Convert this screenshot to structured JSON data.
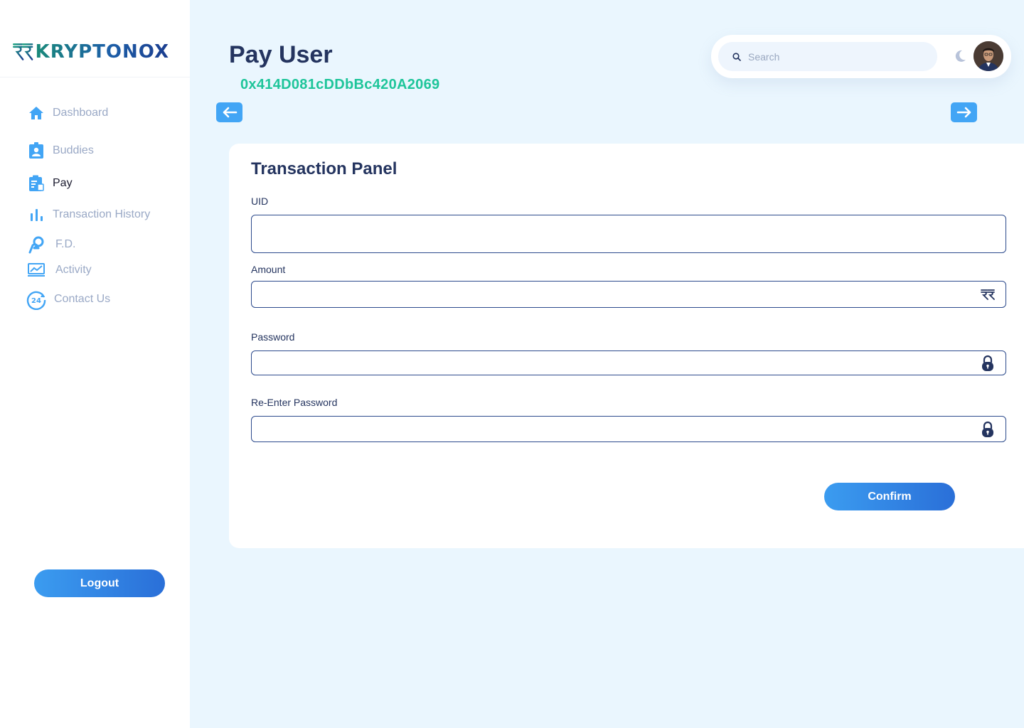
{
  "brand": {
    "name": "KRYPTONOX"
  },
  "sidebar": {
    "items": [
      {
        "label": "Dashboard",
        "icon": "home-icon",
        "active": false
      },
      {
        "label": "Buddies",
        "icon": "contact-badge-icon",
        "active": false
      },
      {
        "label": "Pay",
        "icon": "clipboard-icon",
        "active": true
      },
      {
        "label": "Transaction History",
        "icon": "bar-chart-icon",
        "active": false
      },
      {
        "label": "F.D.",
        "icon": "hand-coin-icon",
        "active": false
      },
      {
        "label": "Activity",
        "icon": "activity-chart-icon",
        "active": false
      },
      {
        "label": "Contact Us",
        "icon": "support-24-icon",
        "active": false
      }
    ],
    "logout_label": "Logout",
    "support_badge": "24"
  },
  "header": {
    "title": "Pay User",
    "wallet_address": "0x414D081cDDbBc420A2069",
    "back_icon": "arrow-left-icon",
    "forward_icon": "arrow-right-icon"
  },
  "topbar": {
    "search_placeholder": "Search",
    "search_icon": "search-icon",
    "theme_icon": "moon-icon",
    "avatar_icon": "user-avatar"
  },
  "panel": {
    "title": "Transaction Panel",
    "fields": [
      {
        "label": "UID",
        "value": "",
        "icon": ""
      },
      {
        "label": "Amount",
        "value": "",
        "icon": "currency-icon"
      },
      {
        "label": "Password",
        "value": "",
        "icon": "lock-icon"
      },
      {
        "label": "Re-Enter Password",
        "value": "",
        "icon": "lock-icon"
      }
    ],
    "confirm_label": "Confirm"
  },
  "colors": {
    "background": "#eaf6fe",
    "primary": "#3b9cf0",
    "navy": "#24345f",
    "address_green": "#1ec59a",
    "nav_inactive": "#9aa9c6",
    "icon_blue": "#42a5f5"
  }
}
